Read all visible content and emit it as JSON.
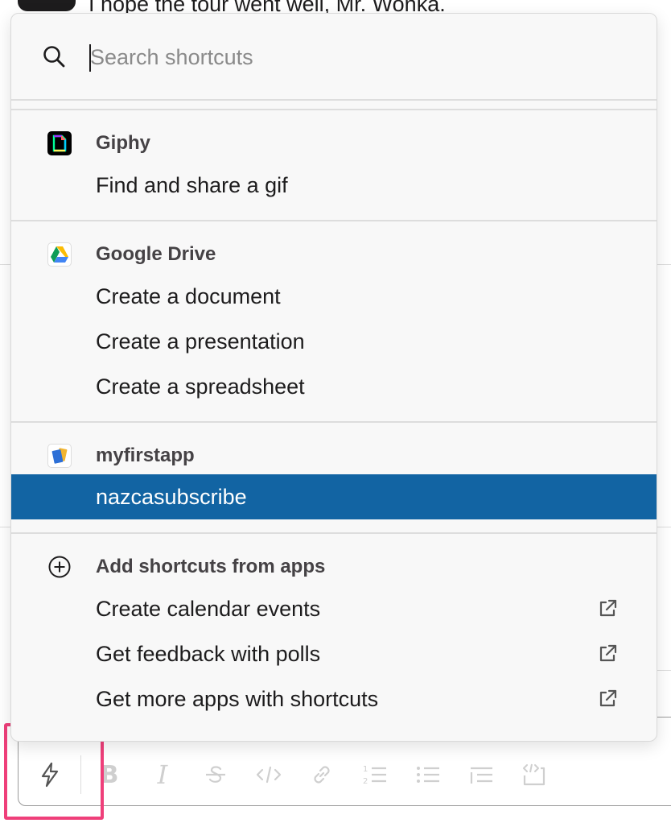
{
  "background": {
    "message": "I hope the tour went well, Mr. Wonka."
  },
  "search": {
    "placeholder": "Search shortcuts",
    "value": ""
  },
  "sections": [
    {
      "app": "Giphy",
      "icon": "giphy-icon",
      "items": [
        "Find and share a gif"
      ]
    },
    {
      "app": "Google Drive",
      "icon": "google-drive-icon",
      "items": [
        "Create a document",
        "Create a presentation",
        "Create a spreadsheet"
      ]
    },
    {
      "app": "myfirstapp",
      "icon": "app-icon",
      "items": [
        "nazcasubscribe"
      ],
      "selected_item": "nazcasubscribe"
    }
  ],
  "add_shortcuts": {
    "title": "Add shortcuts from apps",
    "icon": "plus-circle-icon",
    "items": [
      {
        "label": "Create calendar events",
        "icon": "external-link-icon"
      },
      {
        "label": "Get feedback with polls",
        "icon": "external-link-icon"
      },
      {
        "label": "Get more apps with shortcuts",
        "icon": "external-link-icon"
      }
    ]
  },
  "toolbar": {
    "buttons": [
      "shortcuts-icon",
      "bold-icon",
      "italic-icon",
      "strikethrough-icon",
      "code-icon",
      "link-icon",
      "ordered-list-icon",
      "bulleted-list-icon",
      "blockquote-icon",
      "code-block-icon"
    ]
  },
  "colors": {
    "selected_bg": "#1264a3",
    "highlight": "#ef3f7a"
  }
}
